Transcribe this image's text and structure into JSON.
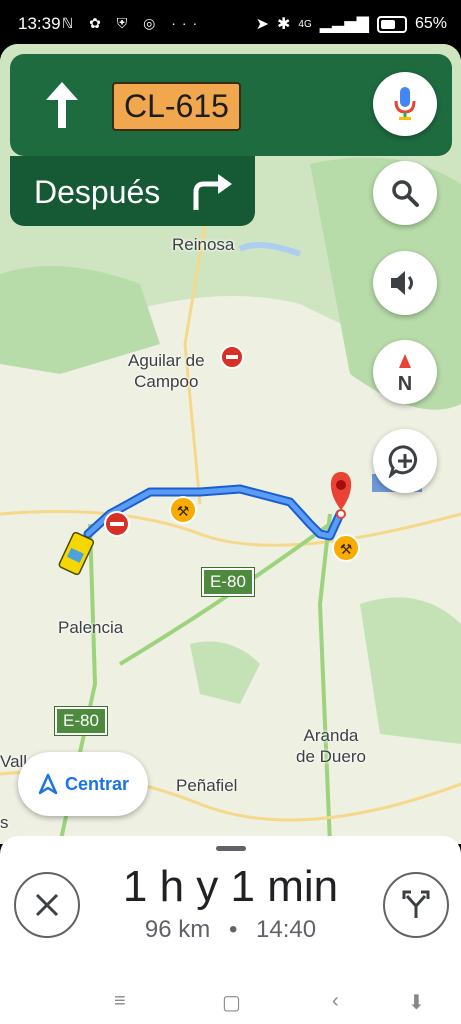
{
  "status": {
    "time": "13:39",
    "notifications": "ℕ ✿ ⛨ ◎ ···",
    "signal": "4G",
    "battery": "65%",
    "battery_level": 0.65
  },
  "nav": {
    "road": "CL-615",
    "then_label": "Después"
  },
  "map": {
    "places": [
      {
        "name": "Reinosa"
      },
      {
        "name": "Aguilar de\nCampoo"
      },
      {
        "name": "Palencia"
      },
      {
        "name": "Aranda\nde Duero"
      },
      {
        "name": "Peñafiel"
      },
      {
        "name": "Vall"
      },
      {
        "name": "s"
      }
    ],
    "roads": [
      "E-80",
      "E-80"
    ]
  },
  "centrar_label": "Centrar",
  "trip": {
    "duration": "1 h y 1 min",
    "distance": "96 km",
    "dot": "•",
    "arrival": "14:40"
  },
  "colors": {
    "nav_green": "#1e6b40",
    "accent": "#1a73e8",
    "route": "#4285f4"
  }
}
